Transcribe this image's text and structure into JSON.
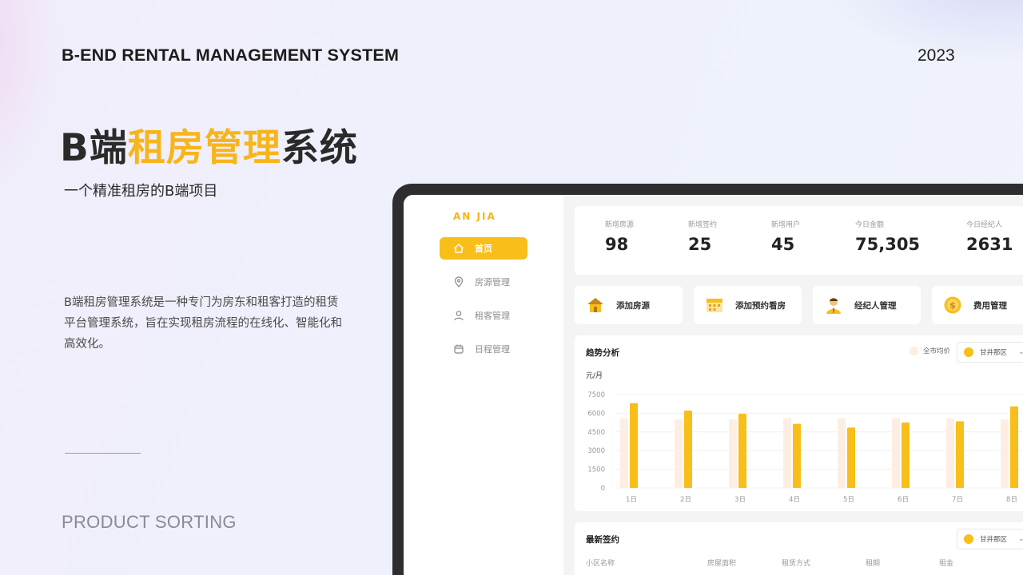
{
  "header": {
    "title": "B-END RENTAL MANAGEMENT SYSTEM",
    "year": "2023"
  },
  "hero": {
    "prefix": "B端",
    "accent": "租房管理",
    "suffix": "系统",
    "subtitle": "一个精准租房的B端项目"
  },
  "description": "B端租房管理系统是一种专门为房东和租客打造的租赁平台管理系统，旨在实现租房流程的在线化、智能化和高效化。",
  "footer": {
    "label": "PRODUCT SORTING"
  },
  "colors": {
    "accent": "#f8be19",
    "accent_light": "#fdeee3",
    "text_dark": "#222222"
  },
  "app": {
    "logo": "AN JIA",
    "sidebar": [
      {
        "label": "首页",
        "icon": "home-icon",
        "active": true
      },
      {
        "label": "房源管理",
        "icon": "location-pin-icon",
        "active": false
      },
      {
        "label": "租客管理",
        "icon": "user-icon",
        "active": false
      },
      {
        "label": "日程管理",
        "icon": "calendar-icon",
        "active": false
      }
    ],
    "stats": [
      {
        "label": "新增房源",
        "value": "98"
      },
      {
        "label": "新增签约",
        "value": "25"
      },
      {
        "label": "新增用户",
        "value": "45"
      },
      {
        "label": "今日金额",
        "value": "75,305"
      },
      {
        "label": "今日经纪人",
        "value": "2631"
      }
    ],
    "quick_actions": [
      {
        "label": "添加房源",
        "icon": "house-icon"
      },
      {
        "label": "添加预约看房",
        "icon": "calendar-icon"
      },
      {
        "label": "经纪人管理",
        "icon": "agent-icon"
      },
      {
        "label": "费用管理",
        "icon": "coin-icon"
      }
    ],
    "trend": {
      "title": "趋势分析",
      "legend_city": "全市均价",
      "district": "甘井那区"
    },
    "recent": {
      "title": "最新签约",
      "district": "甘井那区",
      "columns": [
        "小区名称",
        "房屋面积",
        "租赁方式",
        "租期",
        "租金"
      ]
    }
  },
  "chart_data": {
    "type": "bar",
    "ylabel": "元/月",
    "ylim": [
      0,
      7500
    ],
    "yticks": [
      0,
      1500,
      3000,
      4500,
      6000,
      7500
    ],
    "categories": [
      "1日",
      "2日",
      "3日",
      "4日",
      "5日",
      "6日",
      "7日",
      "8日"
    ],
    "series": [
      {
        "name": "全市均价",
        "values": [
          5600,
          5500,
          5500,
          5600,
          5600,
          5600,
          5600,
          5500
        ]
      },
      {
        "name": "甘井那区",
        "values": [
          6800,
          6200,
          5950,
          5150,
          4850,
          5250,
          5350,
          6550
        ]
      }
    ]
  }
}
